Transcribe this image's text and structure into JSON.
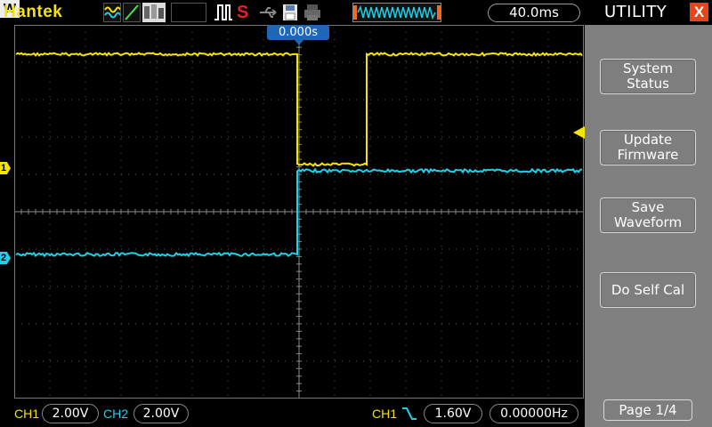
{
  "top_bar": {
    "brand": "Hantek",
    "status_icon": "S",
    "memory_icon": "W",
    "timebase": "40.0ms",
    "icons": [
      "waveform-mode-icon",
      "vector-line-icon",
      "persistence-icon",
      "pulse-trigger-icon",
      "usb-icon",
      "save-disk-icon",
      "printer-icon",
      "memory-timeline-icon"
    ]
  },
  "plot": {
    "time_offset": "0.000s",
    "ch1_marker": "1",
    "ch2_marker": "2",
    "grid": true,
    "divisions": {
      "x": 16,
      "y": 10
    }
  },
  "bottom_bar": {
    "ch1_label": "CH1",
    "ch1_volts": "2.00V",
    "ch2_label": "CH2",
    "ch2_volts": "2.00V",
    "trigger_source": "CH1",
    "trigger_edge": "falling",
    "trigger_level": "1.60V",
    "frequency": "0.00000Hz"
  },
  "menu": {
    "title": "UTILITY",
    "close": "X",
    "buttons": [
      {
        "line1": "System",
        "line2": "Status"
      },
      {
        "line1": "Update",
        "line2": "Firmware"
      },
      {
        "line1": "Save",
        "line2": "Waveform"
      },
      {
        "line1": "Do Self Cal"
      }
    ],
    "page": "Page 1/4"
  },
  "colors": {
    "ch1": "#f5e400",
    "ch2": "#1cd1e8",
    "trigger": "#f5e400",
    "accent": "#1f66b4",
    "menu_bg": "#808080",
    "close": "#e8441b"
  }
}
